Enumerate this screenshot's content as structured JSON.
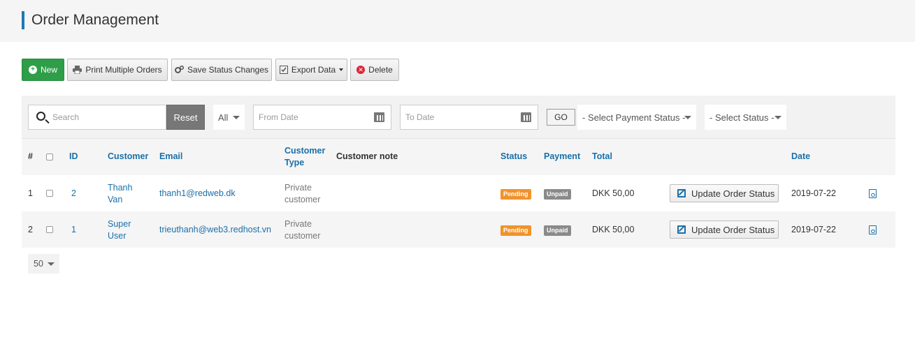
{
  "page": {
    "title": "Order Management"
  },
  "toolbar": {
    "new_label": "New",
    "print_label": "Print Multiple Orders",
    "save_status_label": "Save Status Changes",
    "export_label": "Export Data",
    "delete_label": "Delete"
  },
  "filters": {
    "search_placeholder": "Search",
    "reset_label": "Reset",
    "type_selected": "All",
    "from_date_placeholder": "From Date",
    "to_date_placeholder": "To Date",
    "go_label": "GO",
    "payment_status_selected": "- Select Payment Status -",
    "status_selected": "- Select Status -"
  },
  "table": {
    "columns": {
      "num": "#",
      "id": "ID",
      "customer": "Customer",
      "email": "Email",
      "customer_type_1": "Customer",
      "customer_type_2": "Type",
      "note": "Customer note",
      "status": "Status",
      "payment": "Payment",
      "total": "Total",
      "date": "Date"
    },
    "rows": [
      {
        "num": "1",
        "id": "2",
        "customer_1": "Thanh",
        "customer_2": "Van",
        "email": "thanh1@redweb.dk",
        "type_1": "Private",
        "type_2": "customer",
        "note": "",
        "status": "Pending",
        "payment": "Unpaid",
        "total": "DKK 50,00",
        "action": "Update Order Status",
        "date": "2019-07-22"
      },
      {
        "num": "2",
        "id": "1",
        "customer_1": "Super",
        "customer_2": "User",
        "email": "trieuthanh@web3.redhost.vn",
        "type_1": "Private",
        "type_2": "customer",
        "note": "",
        "status": "Pending",
        "payment": "Unpaid",
        "total": "DKK 50,00",
        "action": "Update Order Status",
        "date": "2019-07-22"
      }
    ]
  },
  "pagination": {
    "page_size": "50"
  },
  "colors": {
    "accent": "#1a7ab5",
    "new_button": "#2e9e48",
    "pending": "#f0932c",
    "unpaid": "#8a8a8a",
    "delete": "#d9263a"
  }
}
